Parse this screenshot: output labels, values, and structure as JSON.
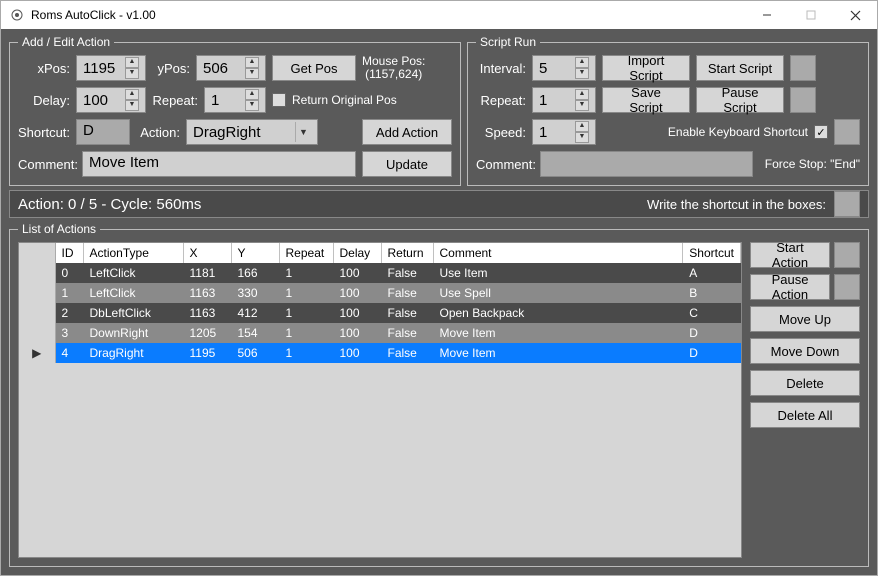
{
  "window": {
    "title": "Roms AutoClick - v1.00"
  },
  "addEdit": {
    "legend": "Add / Edit Action",
    "xpos_label": "xPos:",
    "xpos": "1195",
    "ypos_label": "yPos:",
    "ypos": "506",
    "getpos": "Get Pos",
    "mousepos_label": "Mouse Pos:",
    "mousepos_value": "(1157,624)",
    "delay_label": "Delay:",
    "delay": "100",
    "repeat_label": "Repeat:",
    "repeat": "1",
    "return_label": "Return Original Pos",
    "shortcut_label": "Shortcut:",
    "shortcut": "D",
    "action_label": "Action:",
    "action": "DragRight",
    "addaction": "Add Action",
    "comment_label": "Comment:",
    "comment": "Move Item",
    "update": "Update"
  },
  "scriptRun": {
    "legend": "Script Run",
    "interval_label": "Interval:",
    "interval": "5",
    "import": "Import Script",
    "start": "Start Script",
    "repeat_label": "Repeat:",
    "repeat": "1",
    "save": "Save Script",
    "pause": "Pause Script",
    "speed_label": "Speed:",
    "speed": "1",
    "enable_kb": "Enable Keyboard Shortcut",
    "comment_label": "Comment:",
    "comment": "",
    "forcestop": "Force Stop: \"End\""
  },
  "status": {
    "action_text": "Action: 0 / 5 - Cycle: 560ms",
    "hint": "Write the shortcut in the boxes:"
  },
  "list": {
    "legend": "List of Actions",
    "cols": {
      "id": "ID",
      "type": "ActionType",
      "x": "X",
      "y": "Y",
      "repeat": "Repeat",
      "delay": "Delay",
      "ret": "Return",
      "comment": "Comment",
      "shortcut": "Shortcut"
    },
    "rows": [
      {
        "id": "0",
        "type": "LeftClick",
        "x": "1181",
        "y": "166",
        "repeat": "1",
        "delay": "100",
        "ret": "False",
        "comment": "Use Item",
        "shortcut": "A"
      },
      {
        "id": "1",
        "type": "LeftClick",
        "x": "1163",
        "y": "330",
        "repeat": "1",
        "delay": "100",
        "ret": "False",
        "comment": "Use Spell",
        "shortcut": "B"
      },
      {
        "id": "2",
        "type": "DbLeftClick",
        "x": "1163",
        "y": "412",
        "repeat": "1",
        "delay": "100",
        "ret": "False",
        "comment": "Open Backpack",
        "shortcut": "C"
      },
      {
        "id": "3",
        "type": "DownRight",
        "x": "1205",
        "y": "154",
        "repeat": "1",
        "delay": "100",
        "ret": "False",
        "comment": "Move Item",
        "shortcut": "D"
      },
      {
        "id": "4",
        "type": "DragRight",
        "x": "1195",
        "y": "506",
        "repeat": "1",
        "delay": "100",
        "ret": "False",
        "comment": "Move Item",
        "shortcut": "D"
      }
    ],
    "selected_marker": "▶"
  },
  "side": {
    "start": "Start Action",
    "pause": "Pause Action",
    "moveup": "Move Up",
    "movedown": "Move Down",
    "delete": "Delete",
    "deleteall": "Delete All"
  }
}
